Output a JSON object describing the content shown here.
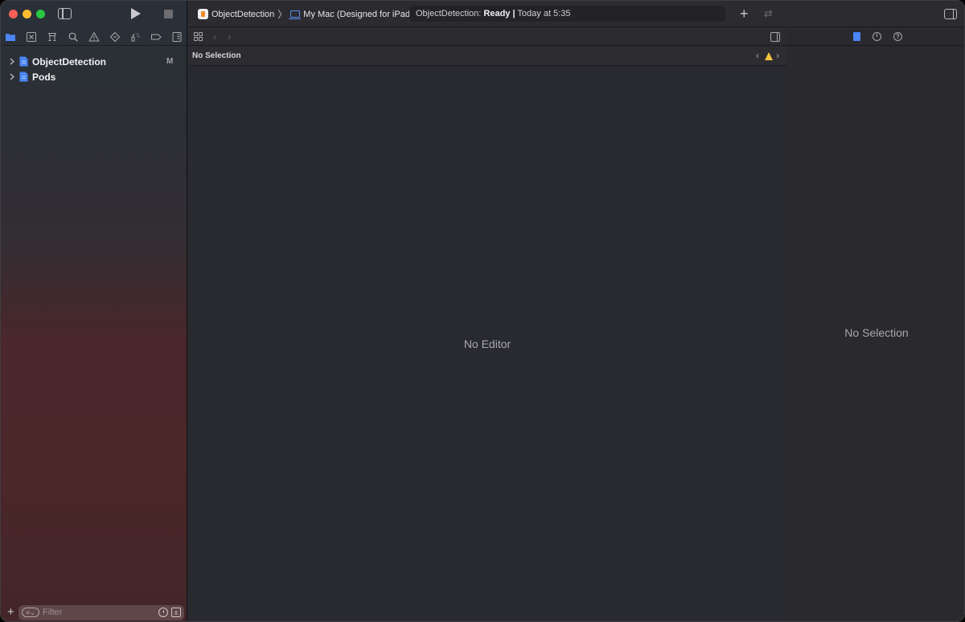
{
  "toolbar": {
    "scheme_name": "ObjectDetection",
    "destination": "My Mac (Designed for iPad)",
    "status_project": "ObjectDetection:",
    "status_state": "Ready",
    "status_separator": "|",
    "status_time": "Today at 5:35",
    "warning_count": "2",
    "add_label": "+",
    "swap_label": "⇄"
  },
  "navigator": {
    "tree": [
      {
        "label": "ObjectDetection",
        "badge": "M"
      },
      {
        "label": "Pods",
        "badge": ""
      }
    ],
    "filter_placeholder": "Filter",
    "add_label": "+"
  },
  "editor": {
    "path_label": "No Selection",
    "empty_label": "No Editor"
  },
  "inspector": {
    "empty_label": "No Selection"
  },
  "colors": {
    "accent": "#4b86f5",
    "warning": "#f5c542",
    "close": "#fe5f57",
    "minimize": "#febc2e",
    "maximize": "#28c840"
  }
}
